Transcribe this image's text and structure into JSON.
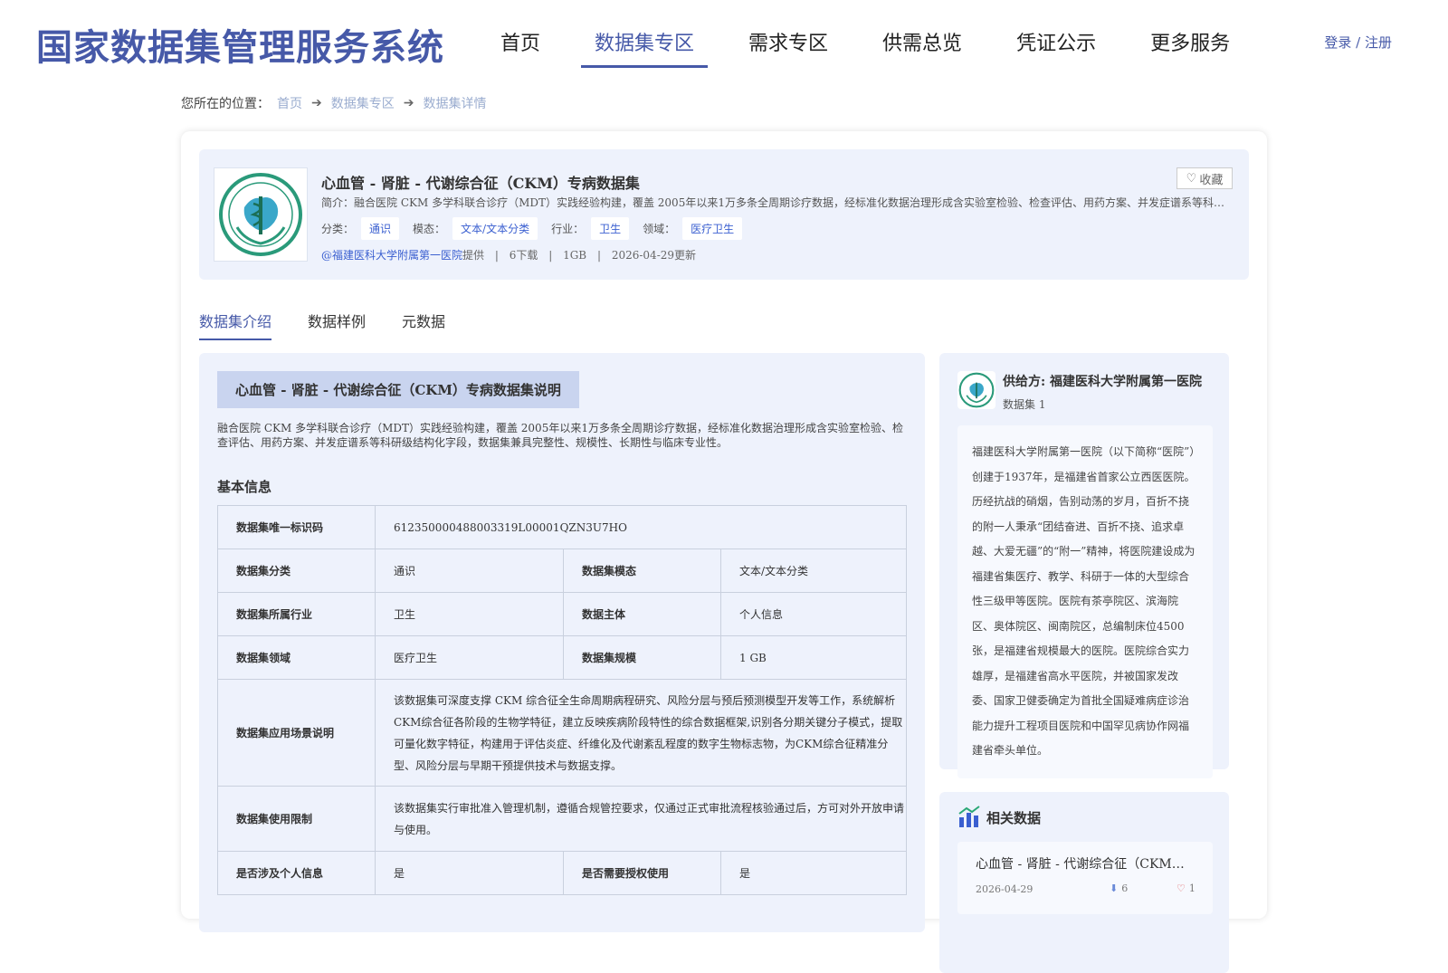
{
  "app": {
    "title": "国家数据集管理服务系统",
    "login": "登录 / 注册"
  },
  "nav": {
    "items": [
      {
        "label": "首页"
      },
      {
        "label": "数据集专区"
      },
      {
        "label": "需求专区"
      },
      {
        "label": "供需总览"
      },
      {
        "label": "凭证公示"
      },
      {
        "label": "更多服务"
      }
    ],
    "active_index": 1
  },
  "breadcrumb": {
    "prefix": "您所在的位置：",
    "items": [
      "首页",
      "数据集专区",
      "数据集详情"
    ]
  },
  "dataset": {
    "title": "心血管 - 肾脏 - 代谢综合征（CKM）专病数据集",
    "favorite_label": "收藏",
    "intro": "简介：融合医院 CKM 多学科联合诊疗（MDT）实践经验构建，覆盖 2005年以来1万多条全周期诊疗数据，经标准化数据治理形成含实验室检验、检查评估、用药方案、并发症谱系等科研级结构化字段，数据集兼具完整性、规模性、长期性与临床专业性。",
    "tags": [
      {
        "label": "分类：",
        "value": "通识"
      },
      {
        "label": "模态：",
        "value": "文本/文本分类"
      },
      {
        "label": "行业：",
        "value": "卫生"
      },
      {
        "label": "领域：",
        "value": "医疗卫生"
      }
    ],
    "provider": "@福建医科大学附属第一医院",
    "provider_suffix": "提供",
    "downloads": "6下载",
    "size": "1GB",
    "updated": "2026-04-29更新",
    "sep": "|"
  },
  "tabs": [
    {
      "label": "数据集介绍"
    },
    {
      "label": "数据样例"
    },
    {
      "label": "元数据"
    }
  ],
  "description": {
    "title": "心血管 - 肾脏 - 代谢综合征（CKM）专病数据集说明",
    "text": "融合医院 CKM 多学科联合诊疗（MDT）实践经验构建，覆盖 2005年以来1万多条全周期诊疗数据，经标准化数据治理形成含实验室检验、检查评估、用药方案、并发症谱系等科研级结构化字段，数据集兼具完整性、规模性、长期性与临床专业性。",
    "basic_info_title": "基本信息"
  },
  "info_table": {
    "id_label": "数据集唯一标识码",
    "id_value": "612350000488003319L00001QZN3U7HO",
    "rows": [
      {
        "k1": "数据集分类",
        "v1": "通识",
        "k2": "数据集模态",
        "v2": "文本/文本分类"
      },
      {
        "k1": "数据集所属行业",
        "v1": "卫生",
        "k2": "数据主体",
        "v2": "个人信息"
      },
      {
        "k1": "数据集领域",
        "v1": "医疗卫生",
        "k2": "数据集规模",
        "v2": "1 GB"
      }
    ],
    "scenario_label": "数据集应用场景说明",
    "scenario_value": "该数据集可深度支撑 CKM 综合征全生命周期病程研究、风险分层与预后预测模型开发等工作，系统解析CKM综合征各阶段的生物学特征，建立反映疾病阶段特性的综合数据框架,识别各分期关键分子模式，提取可量化数字特征，构建用于评估炎症、纤维化及代谢紊乱程度的数字生物标志物，为CKM综合征精准分型、风险分层与早期干预提供技术与数据支撑。",
    "limit_label": "数据集使用限制",
    "limit_value": "该数据集实行审批准入管理机制，遵循合规管控要求，仅通过正式审批流程核验通过后，方可对外开放申请与使用。",
    "last": {
      "k1": "是否涉及个人信息",
      "v1": "是",
      "k2": "是否需要授权使用",
      "v2": "是"
    }
  },
  "supplier": {
    "name": "供给方: 福建医科大学附属第一医院",
    "count": "数据集 1",
    "desc": "福建医科大学附属第一医院（以下简称“医院”）创建于1937年，是福建省首家公立西医医院。历经抗战的硝烟，告别动荡的岁月，百折不挠的附一人秉承“团结奋进、百折不挠、追求卓越、大爱无疆”的“附一”精神，将医院建设成为福建省集医疗、教学、科研于一体的大型综合性三级甲等医院。医院有茶亭院区、滨海院区、奥体院区、闽南院区，总编制床位4500张，是福建省规模最大的医院。医院综合实力雄厚，是福建省高水平医院，并被国家发改委、国家卫健委确定为首批全国疑难病症诊治能力提升工程项目医院和中国罕见病协作网福建省牵头单位。"
  },
  "related": {
    "title": "相关数据",
    "items": [
      {
        "name": "心血管 - 肾脏 - 代谢综合征（CKM）专病数据集",
        "date": "2026-04-29",
        "downloads": "6",
        "likes": "1"
      }
    ]
  },
  "colors": {
    "brand": "#4659a8",
    "tag_text": "#3a5fd0",
    "panel_bg": "#eef2fc"
  }
}
